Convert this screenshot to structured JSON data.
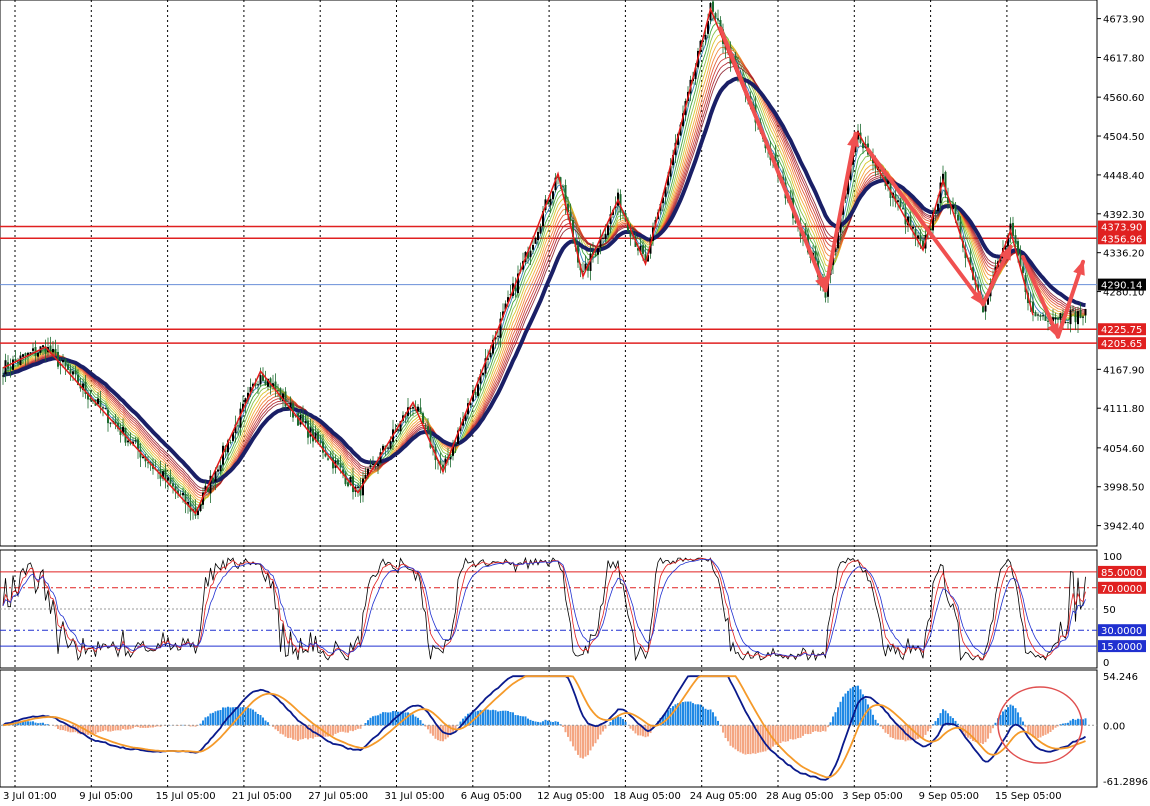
{
  "colors": {
    "up_candle": "#1b6b2e",
    "down_candle": "#1b6b2e",
    "ma_main": "#1a1f66",
    "resistance": "#e02020",
    "pivot": "#6a8fd8",
    "zigzag": "#e21b1b",
    "arrow": "#f05050",
    "stoch_main": "#000000",
    "stoch_signal1": "#e02020",
    "stoch_signal2": "#2030d0",
    "macd_hist_pos": "#1e88e5",
    "macd_hist_neg": "#f4a582",
    "macd_line": "#0a1a8c",
    "macd_signal": "#f59a2a",
    "circle": "#e05050"
  },
  "chart_data": [
    {
      "type": "candlestick",
      "panel": "price",
      "y_ticks": [
        "4673.90",
        "4617.80",
        "4560.60",
        "4504.50",
        "4448.40",
        "4392.30",
        "4336.20",
        "4280.10",
        "4167.90",
        "4111.80",
        "4054.60",
        "3998.50",
        "3942.40"
      ],
      "ylim": [
        3913,
        4695
      ],
      "x_tick_labels": [
        "3 Jul 01:00",
        "9 Jul 05:00",
        "15 Jul 05:00",
        "21 Jul 05:00",
        "27 Jul 05:00",
        "31 Jul 05:00",
        "6 Aug 05:00",
        "12 Aug 05:00",
        "18 Aug 05:00",
        "24 Aug 05:00",
        "28 Aug 05:00",
        "3 Sep 05:00",
        "9 Sep 05:00",
        "15 Sep 05:00"
      ],
      "horizontal_levels": [
        {
          "value": 4373.9,
          "label": "4373.90",
          "color": "#e02020"
        },
        {
          "value": 4356.96,
          "label": "4356.96",
          "color": "#e02020"
        },
        {
          "value": 4290.14,
          "label": "4290.14",
          "color": "#6a8fd8",
          "current": true
        },
        {
          "value": 4225.75,
          "label": "4225.75",
          "color": "#e02020"
        },
        {
          "value": 4205.65,
          "label": "4205.65",
          "color": "#e02020"
        }
      ],
      "zigzag_prices": [
        {
          "i": 0,
          "p": 4170
        },
        {
          "i": 17,
          "p": 4200
        },
        {
          "i": 77,
          "p": 3960
        },
        {
          "i": 103,
          "p": 4165
        },
        {
          "i": 142,
          "p": 3990
        },
        {
          "i": 164,
          "p": 4120
        },
        {
          "i": 176,
          "p": 4020
        },
        {
          "i": 222,
          "p": 4450
        },
        {
          "i": 232,
          "p": 4302
        },
        {
          "i": 246,
          "p": 4412
        },
        {
          "i": 257,
          "p": 4320
        },
        {
          "i": 283,
          "p": 4688
        },
        {
          "i": 329,
          "p": 4282
        },
        {
          "i": 342,
          "p": 4510
        },
        {
          "i": 368,
          "p": 4340
        },
        {
          "i": 376,
          "p": 4440
        },
        {
          "i": 392,
          "p": 4260
        },
        {
          "i": 403,
          "p": 4368
        },
        {
          "i": 412,
          "p": 4246
        }
      ],
      "forecast_arrows": [
        {
          "from_i": 287,
          "from_p": 4660,
          "to_i": 329,
          "to_p": 4282
        },
        {
          "from_i": 329,
          "from_p": 4282,
          "to_i": 341,
          "to_p": 4508
        },
        {
          "from_i": 346,
          "from_p": 4485,
          "to_i": 392,
          "to_p": 4262
        },
        {
          "from_i": 392,
          "from_p": 4262,
          "to_i": 403,
          "to_p": 4345
        },
        {
          "from_i": 408,
          "from_p": 4330,
          "to_i": 422,
          "to_p": 4215
        },
        {
          "from_i": 422,
          "from_p": 4215,
          "to_i": 432,
          "to_p": 4323
        }
      ],
      "current_price": 4290.14
    },
    {
      "type": "line",
      "panel": "stochastic",
      "ylim": [
        0,
        100
      ],
      "y_ticks": [
        "100",
        "50",
        "0"
      ],
      "levels": [
        {
          "value": 85,
          "label": "85.0000",
          "color": "#e02020",
          "style": "solid"
        },
        {
          "value": 70,
          "label": "70.0000",
          "color": "#e02020",
          "style": "dashdot"
        },
        {
          "value": 30,
          "label": "30.0000",
          "color": "#2030d0",
          "style": "dashdot"
        },
        {
          "value": 15,
          "label": "15.0000",
          "color": "#2030d0",
          "style": "solid"
        }
      ]
    },
    {
      "type": "bar",
      "panel": "macd",
      "ylim": [
        -61.2896,
        54.246
      ],
      "y_ticks": [
        "54.246",
        "0.00",
        "-61.2896"
      ]
    }
  ]
}
